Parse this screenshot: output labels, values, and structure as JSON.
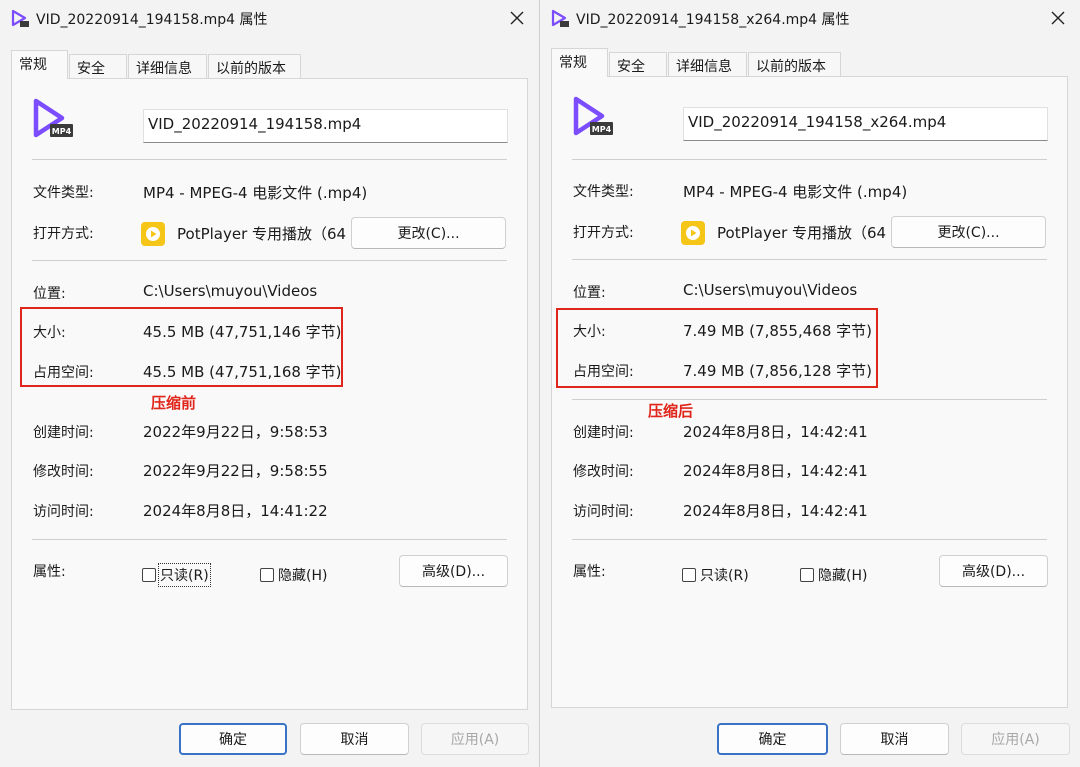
{
  "dialogs": [
    {
      "title": "VID_20220914_194158.mp4 属性",
      "tabs": [
        "常规",
        "安全",
        "详细信息",
        "以前的版本"
      ],
      "filename": "VID_20220914_194158.mp4",
      "icon_badge": "MP4",
      "labels": {
        "type": "文件类型:",
        "opens_with": "打开方式:",
        "location": "位置:",
        "size": "大小:",
        "size_on_disk": "占用空间:",
        "created": "创建时间:",
        "modified": "修改时间:",
        "accessed": "访问时间:",
        "attributes": "属性:"
      },
      "values": {
        "type": "MP4 - MPEG-4 电影文件 (.mp4)",
        "opens_with": "PotPlayer 专用播放（64",
        "location": "C:\\Users\\muyou\\Videos",
        "size": "45.5 MB (47,751,146 字节)",
        "size_on_disk": "45.5 MB (47,751,168 字节)",
        "created": "2022年9月22日，9:58:53",
        "modified": "2022年9月22日，9:58:55",
        "accessed": "2024年8月8日，14:41:22"
      },
      "buttons": {
        "change": "更改(C)...",
        "advanced": "高级(D)...",
        "ok": "确定",
        "cancel": "取消",
        "apply": "应用(A)"
      },
      "checkboxes": {
        "readonly": "只读(R)",
        "hidden": "隐藏(H)"
      },
      "annotation": "压缩前"
    },
    {
      "title": "VID_20220914_194158_x264.mp4 属性",
      "tabs": [
        "常规",
        "安全",
        "详细信息",
        "以前的版本"
      ],
      "filename": "VID_20220914_194158_x264.mp4",
      "icon_badge": "MP4",
      "labels": {
        "type": "文件类型:",
        "opens_with": "打开方式:",
        "location": "位置:",
        "size": "大小:",
        "size_on_disk": "占用空间:",
        "created": "创建时间:",
        "modified": "修改时间:",
        "accessed": "访问时间:",
        "attributes": "属性:"
      },
      "values": {
        "type": "MP4 - MPEG-4 电影文件 (.mp4)",
        "opens_with": "PotPlayer 专用播放（64",
        "location": "C:\\Users\\muyou\\Videos",
        "size": "7.49 MB (7,855,468 字节)",
        "size_on_disk": "7.49 MB (7,856,128 字节)",
        "created": "2024年8月8日，14:42:41",
        "modified": "2024年8月8日，14:42:41",
        "accessed": "2024年8月8日，14:42:41"
      },
      "buttons": {
        "change": "更改(C)...",
        "advanced": "高级(D)...",
        "ok": "确定",
        "cancel": "取消",
        "apply": "应用(A)"
      },
      "checkboxes": {
        "readonly": "只读(R)",
        "hidden": "隐藏(H)"
      },
      "annotation": "压缩后"
    }
  ],
  "colors": {
    "annotation_red": "#e0261b",
    "icon_purple": "#7b4dff",
    "potplayer_yellow": "#f5c518",
    "focus_blue": "#3a72c4"
  }
}
